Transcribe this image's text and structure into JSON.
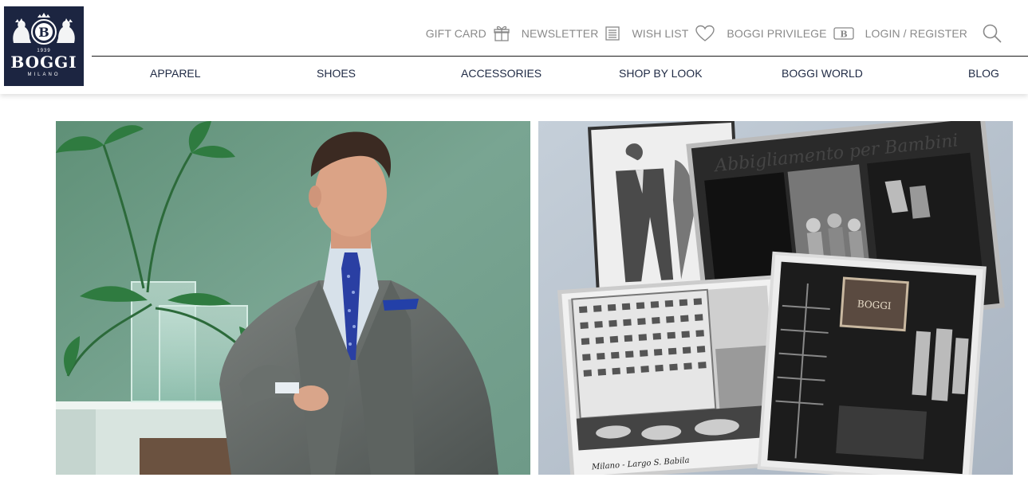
{
  "logo": {
    "brand": "BOGGI",
    "year": "1939",
    "city": "MILANO",
    "monogram": "B"
  },
  "utility": [
    {
      "label": "GIFT CARD",
      "icon": "gift-icon"
    },
    {
      "label": "NEWSLETTER",
      "icon": "newsletter-icon"
    },
    {
      "label": "WISH LIST",
      "icon": "heart-icon"
    },
    {
      "label": "BOGGI PRIVILEGE",
      "icon": "privilege-card-icon",
      "icon_text": "B"
    },
    {
      "label": "LOGIN / REGISTER",
      "icon": ""
    }
  ],
  "search": {
    "icon": "search-icon"
  },
  "nav": [
    {
      "label": "APPAREL"
    },
    {
      "label": "SHOES"
    },
    {
      "label": "ACCESSORIES"
    },
    {
      "label": "SHOP BY LOOK"
    },
    {
      "label": "BOGGI WORLD"
    },
    {
      "label": "BLOG"
    }
  ],
  "heroes": {
    "left": {
      "image": "man-in-grey-suit-photo"
    },
    "right": {
      "image": "vintage-boggi-store-photos"
    }
  },
  "vintage": {
    "store_sign": "BOGGI",
    "postcard_caption": "Milano - Largo S. Babila"
  },
  "colors": {
    "logo_bg": "#1c2541",
    "nav_text": "#1f2a44",
    "utility_text": "#8a8a8a"
  }
}
